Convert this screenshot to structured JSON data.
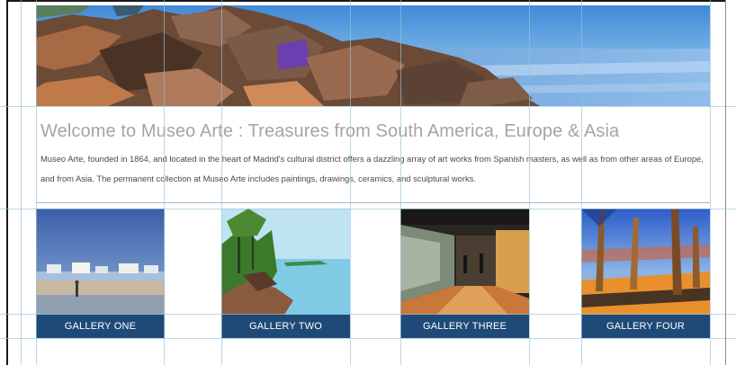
{
  "hero": {
    "icon": "seaside-rocks-painting"
  },
  "intro": {
    "title": "Welcome to Museo Arte : Treasures from South America, Europe & Asia",
    "description": "Museo Arte, founded in 1864, and located in the heart of Madrid's cultural district offers a dazzling array of art works from Spanish masters, as well as from other areas of Europe, and from Asia. The permanent collection at Museo Arte includes paintings, drawings, ceramics, and sculptural works."
  },
  "galleries": [
    {
      "label": "GALLERY ONE",
      "icon": "beach-painting"
    },
    {
      "label": "GALLERY TWO",
      "icon": "lake-island-painting"
    },
    {
      "label": "GALLERY THREE",
      "icon": "museum-interior-painting"
    },
    {
      "label": "GALLERY FOUR",
      "icon": "forest-trees-painting"
    }
  ],
  "colors": {
    "label_bar": "#1f4a78",
    "title_text": "#a5a5a5",
    "guide_lines": "#96c3d7"
  }
}
